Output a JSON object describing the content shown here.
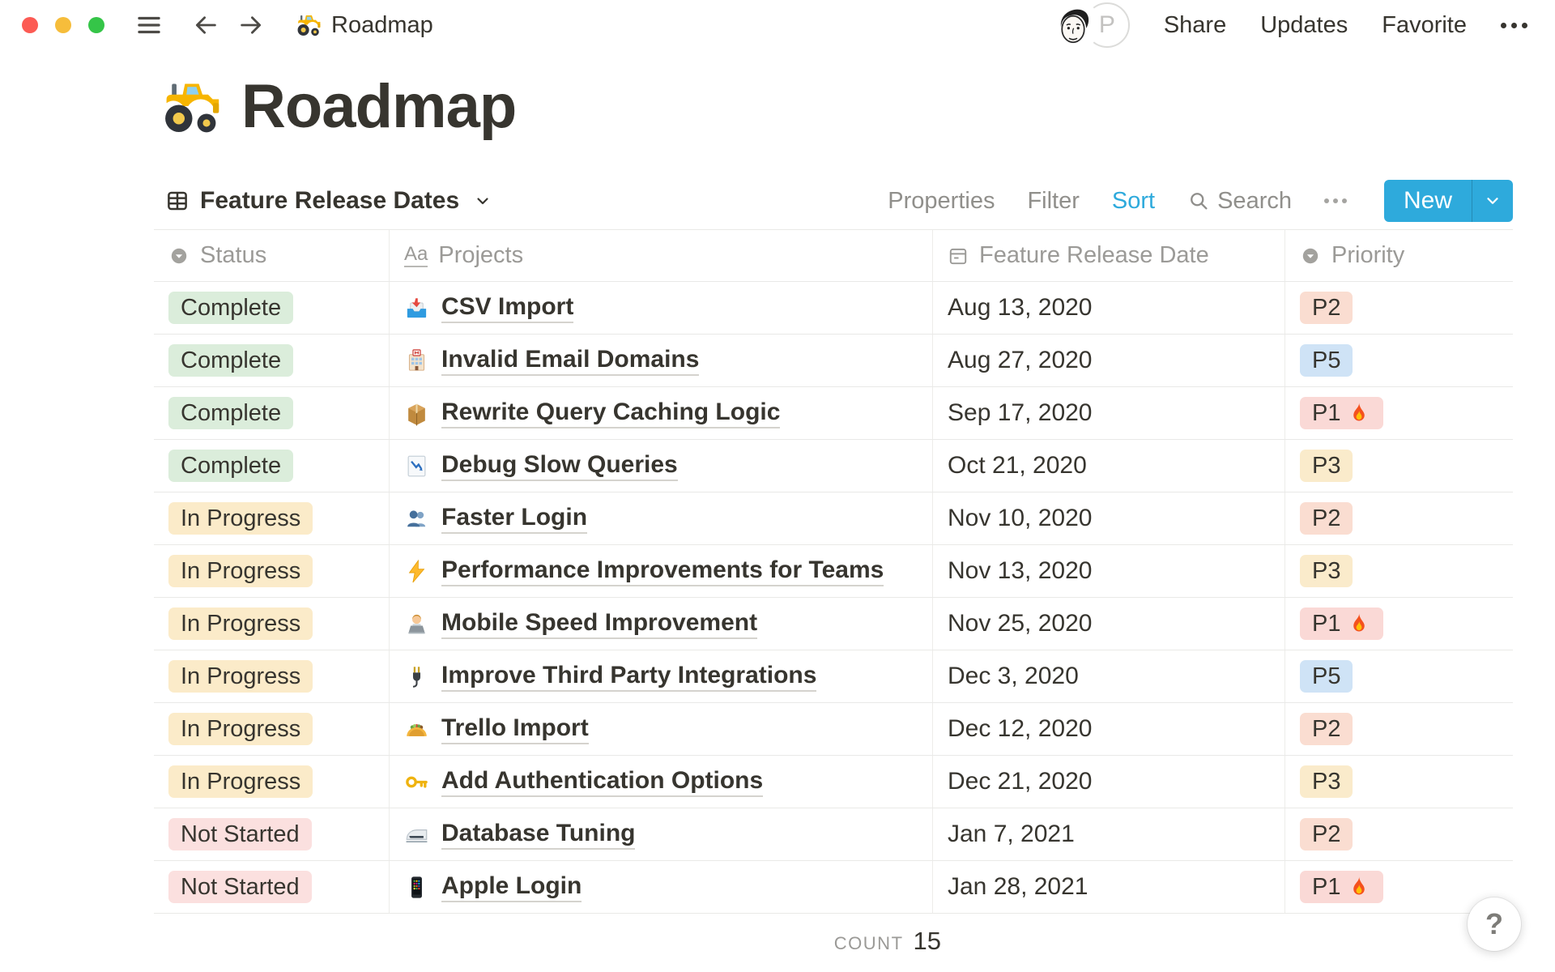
{
  "titlebar": {
    "document_icon": "tractor-icon",
    "document_title": "Roadmap",
    "avatar_initial": "P",
    "actions": {
      "share": "Share",
      "updates": "Updates",
      "favorite": "Favorite"
    }
  },
  "page": {
    "icon": "tractor-icon",
    "title": "Roadmap"
  },
  "view_bar": {
    "view_icon": "table-view-icon",
    "view_name": "Feature Release Dates",
    "toolbar": {
      "properties": "Properties",
      "filter": "Filter",
      "sort": "Sort",
      "search": "Search",
      "more_icon": "ellipsis-icon",
      "new_label": "New"
    }
  },
  "table": {
    "columns": [
      {
        "label": "Status",
        "icon": "select-property-icon"
      },
      {
        "label": "Projects",
        "icon": "title-property-icon",
        "icon_glyph": "Aa"
      },
      {
        "label": "Feature Release Date",
        "icon": "date-property-icon"
      },
      {
        "label": "Priority",
        "icon": "select-property-icon"
      }
    ],
    "rows": [
      {
        "status": "Complete",
        "status_color": "green",
        "project_icon": "inbox-tray-icon",
        "project": "CSV Import",
        "release_date": "Aug 13, 2020",
        "priority": "P2",
        "priority_color": "orange",
        "on_fire": false
      },
      {
        "status": "Complete",
        "status_color": "green",
        "project_icon": "hotel-icon",
        "project": "Invalid Email Domains",
        "release_date": "Aug 27, 2020",
        "priority": "P5",
        "priority_color": "blue",
        "on_fire": false
      },
      {
        "status": "Complete",
        "status_color": "green",
        "project_icon": "package-icon",
        "project": "Rewrite Query Caching Logic",
        "release_date": "Sep 17, 2020",
        "priority": "P1",
        "priority_color": "pink",
        "on_fire": true
      },
      {
        "status": "Complete",
        "status_color": "green",
        "project_icon": "chart-decreasing-icon",
        "project": "Debug Slow Queries",
        "release_date": "Oct 21, 2020",
        "priority": "P3",
        "priority_color": "cream",
        "on_fire": false
      },
      {
        "status": "In Progress",
        "status_color": "yellow",
        "project_icon": "busts-in-silhouette-icon",
        "project": "Faster Login",
        "release_date": "Nov 10, 2020",
        "priority": "P2",
        "priority_color": "orange",
        "on_fire": false
      },
      {
        "status": "In Progress",
        "status_color": "yellow",
        "project_icon": "high-voltage-icon",
        "project": "Performance Improvements for Teams",
        "release_date": "Nov 13, 2020",
        "priority": "P3",
        "priority_color": "cream",
        "on_fire": false
      },
      {
        "status": "In Progress",
        "status_color": "yellow",
        "project_icon": "woman-technologist-icon",
        "project": "Mobile Speed Improvement",
        "release_date": "Nov 25, 2020",
        "priority": "P1",
        "priority_color": "pink",
        "on_fire": true
      },
      {
        "status": "In Progress",
        "status_color": "yellow",
        "project_icon": "electric-plug-icon",
        "project": "Improve Third Party Integrations",
        "release_date": "Dec 3, 2020",
        "priority": "P5",
        "priority_color": "blue",
        "on_fire": false
      },
      {
        "status": "In Progress",
        "status_color": "yellow",
        "project_icon": "taco-icon",
        "project": "Trello Import",
        "release_date": "Dec 12, 2020",
        "priority": "P2",
        "priority_color": "orange",
        "on_fire": false
      },
      {
        "status": "In Progress",
        "status_color": "yellow",
        "project_icon": "key-icon",
        "project": "Add Authentication Options",
        "release_date": "Dec 21, 2020",
        "priority": "P3",
        "priority_color": "cream",
        "on_fire": false
      },
      {
        "status": "Not Started",
        "status_color": "red",
        "project_icon": "high-speed-train-icon",
        "project": "Database Tuning",
        "release_date": "Jan 7, 2021",
        "priority": "P2",
        "priority_color": "orange",
        "on_fire": false
      },
      {
        "status": "Not Started",
        "status_color": "red",
        "project_icon": "mobile-phone-icon",
        "project": "Apple Login",
        "release_date": "Jan 28, 2021",
        "priority": "P1",
        "priority_color": "pink",
        "on_fire": true
      }
    ],
    "footer": {
      "count_label": "COUNT",
      "count_value": "15"
    }
  },
  "help": {
    "label": "?"
  },
  "colors": {
    "accent_blue": "#2EAADC",
    "status_complete_bg": "#DBEDDB",
    "status_in_progress_bg": "#FBEBC9",
    "status_not_started_bg": "#FBE0DF",
    "priority_p1_bg": "#FAD9D6",
    "priority_p2_bg": "#FADDD1",
    "priority_p3_bg": "#FAEBCB",
    "priority_p5_bg": "#CFE3F6",
    "text_dark": "#37352F",
    "text_gray": "#908F8B"
  }
}
